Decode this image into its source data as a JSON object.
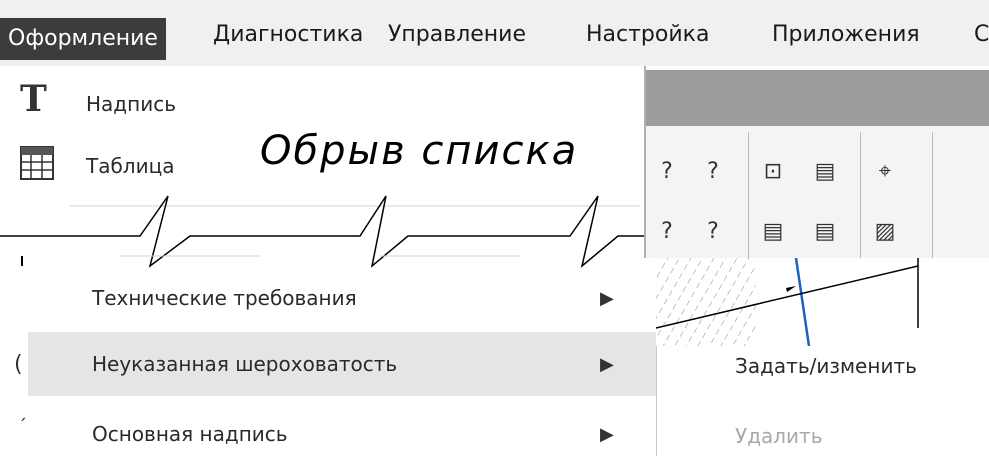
{
  "menubar": {
    "items": [
      {
        "label": "Оформление",
        "active": true
      },
      {
        "label": "Диагностика"
      },
      {
        "label": "Управление"
      },
      {
        "label": "Настройка"
      },
      {
        "label": "Приложения"
      },
      {
        "label": "С"
      }
    ]
  },
  "dropdown": {
    "top_items": [
      {
        "label": "Надпись",
        "icon": "text-T-icon"
      },
      {
        "label": "Таблица",
        "icon": "table-icon"
      }
    ],
    "break_caption": "Обрыв списка",
    "items": [
      {
        "label": "Технические требования",
        "arrow": "▶"
      },
      {
        "label": "Неуказанная шероховатость",
        "arrow": "▶",
        "highlighted": true
      },
      {
        "label": "Основная надпись",
        "arrow": "▶"
      }
    ]
  },
  "submenu": {
    "items": [
      {
        "label": "Задать/изменить",
        "enabled": true
      },
      {
        "label": "Удалить",
        "enabled": false
      }
    ]
  },
  "toolbar": {
    "icons": [
      "?",
      "?",
      "⊡",
      "▤",
      "⌖",
      "?",
      "?",
      "▤",
      "▤",
      "▨"
    ]
  },
  "colors": {
    "active_menu_bg": "#3c3c3c",
    "highlight_bg": "#e5e5e5",
    "disabled_text": "#a8a8a8"
  }
}
